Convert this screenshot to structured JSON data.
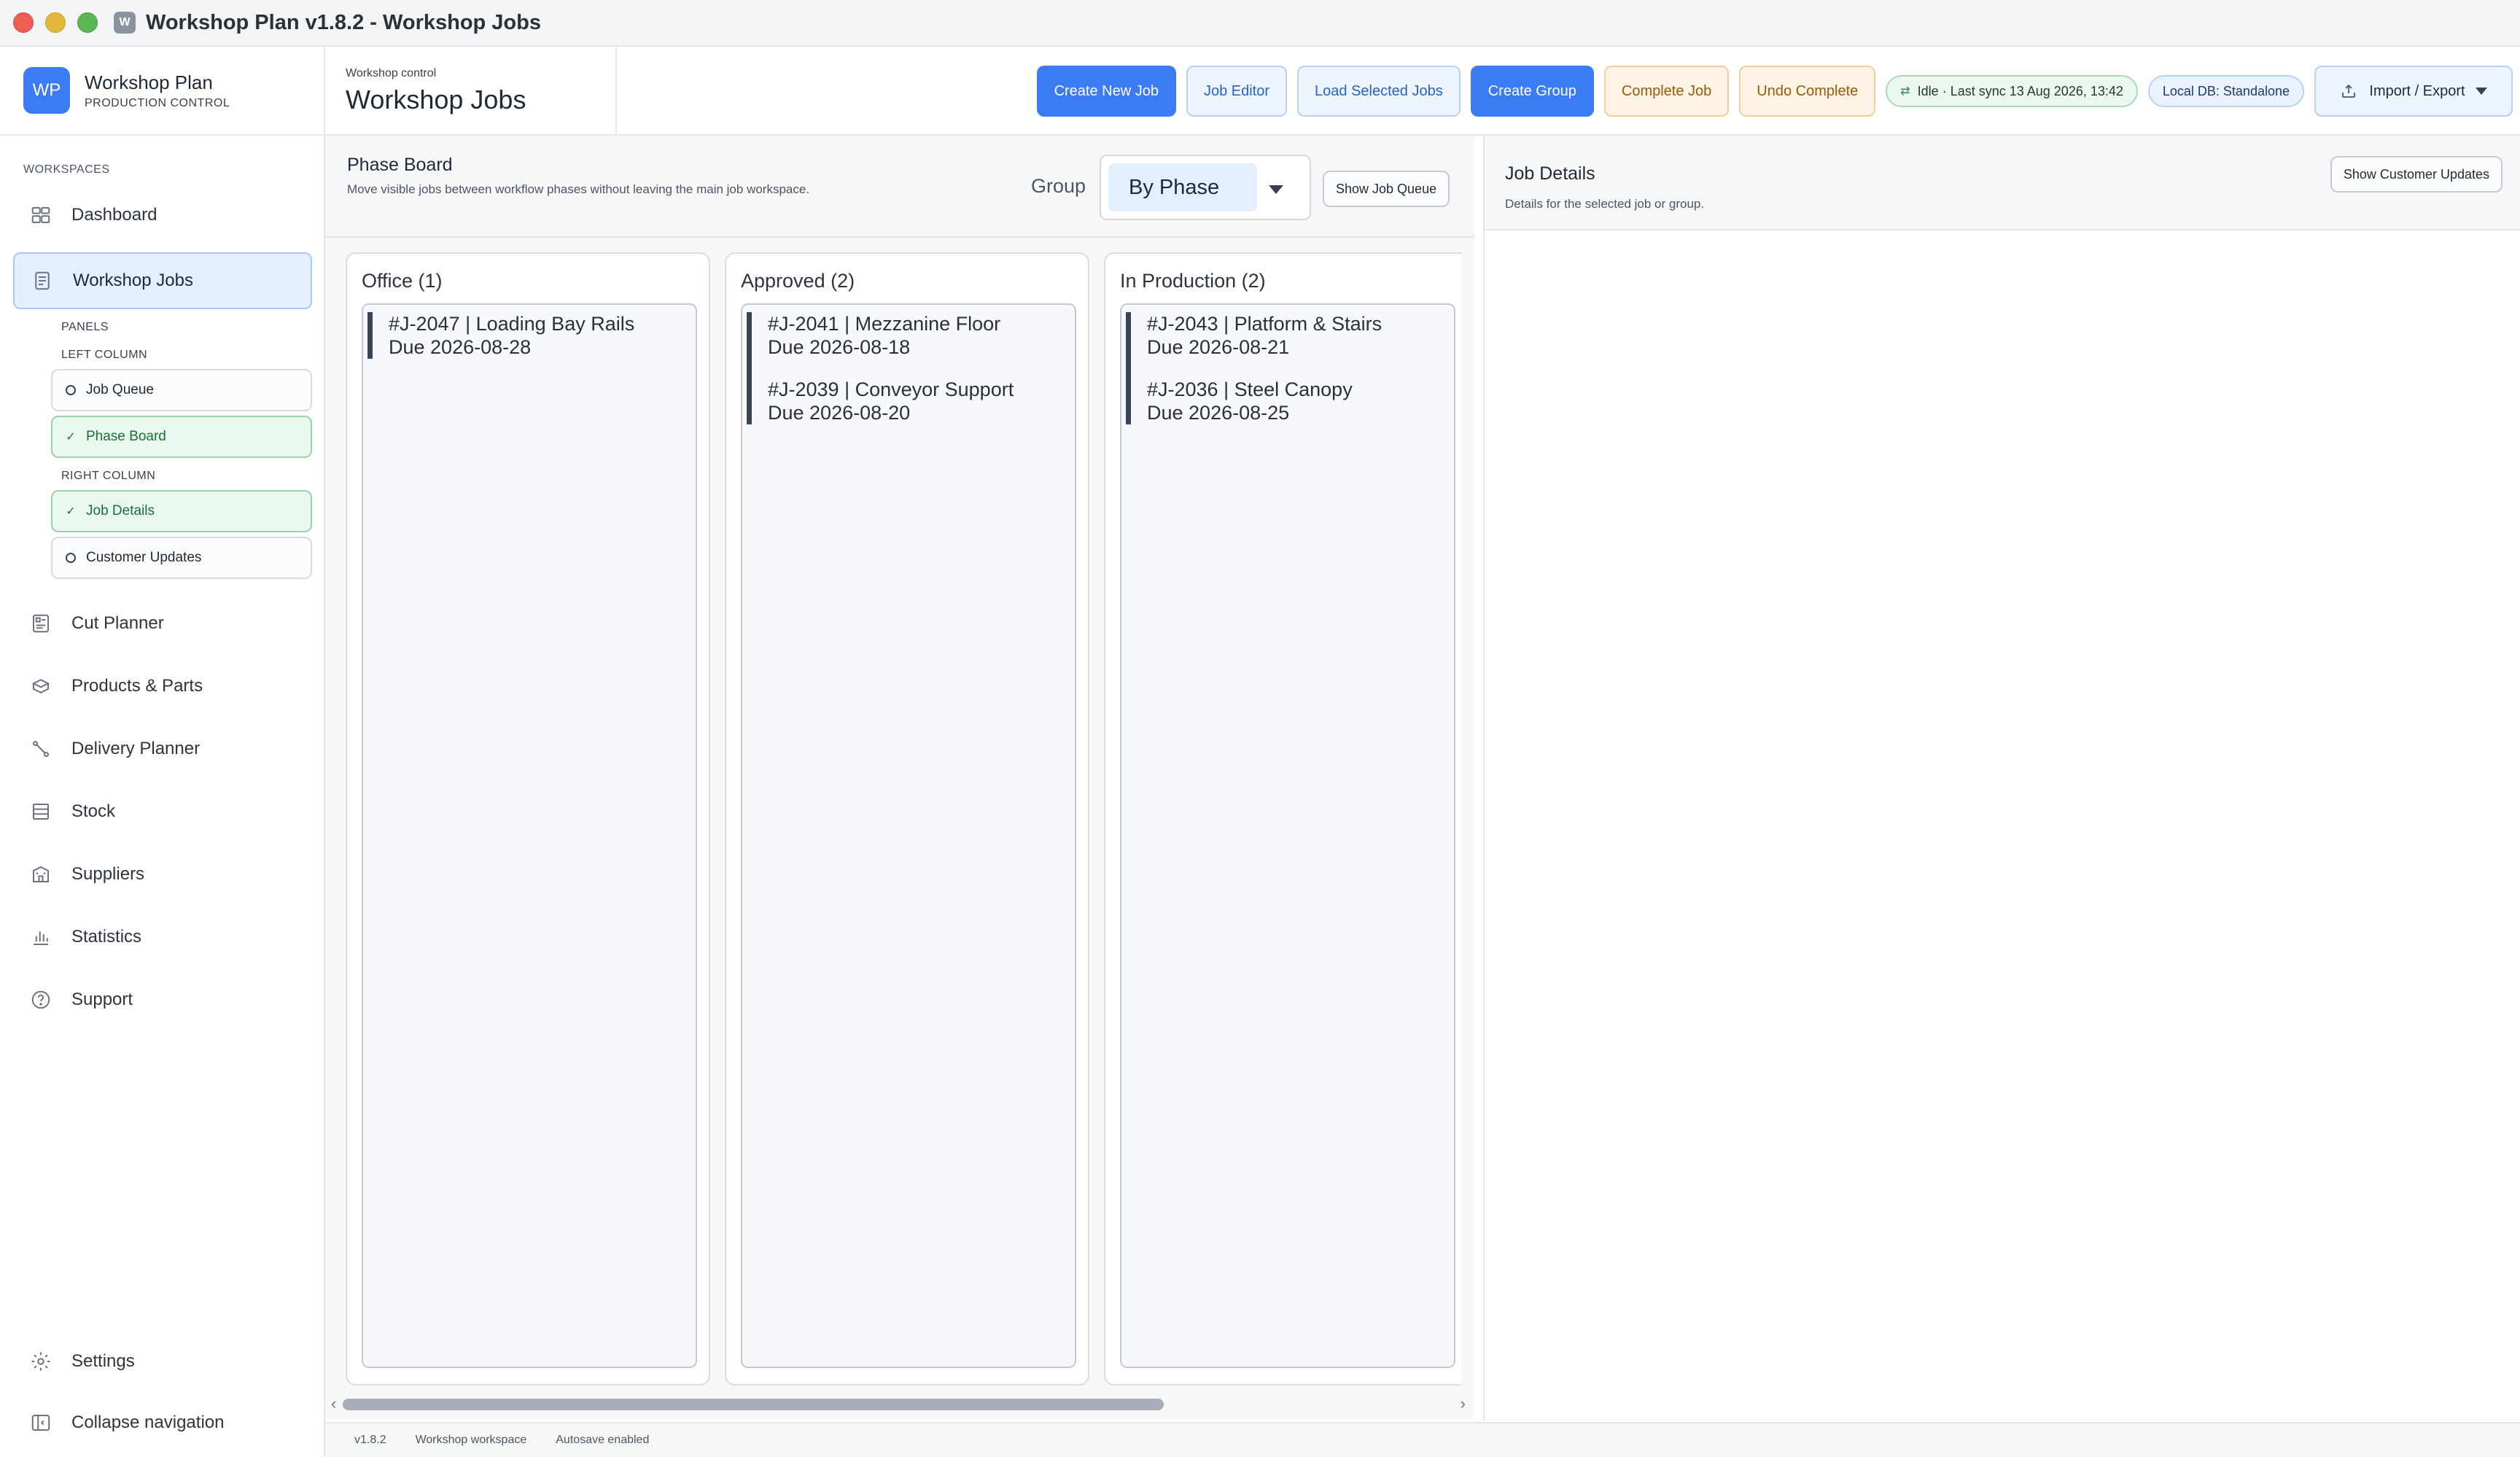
{
  "window": {
    "title": "Workshop Plan v1.8.2 - Workshop Jobs"
  },
  "brand": {
    "logo": "WP",
    "name": "Workshop Plan",
    "subtitle": "PRODUCTION CONTROL"
  },
  "sidebar": {
    "section_label": "WORKSPACES",
    "items": [
      {
        "label": "Dashboard",
        "icon": "dashboard-icon"
      },
      {
        "label": "Workshop Jobs",
        "icon": "document-icon",
        "active": true
      },
      {
        "label": "Cut Planner",
        "icon": "cut-planner-icon"
      },
      {
        "label": "Products & Parts",
        "icon": "parts-icon"
      },
      {
        "label": "Delivery Planner",
        "icon": "route-icon"
      },
      {
        "label": "Stock",
        "icon": "stock-icon"
      },
      {
        "label": "Suppliers",
        "icon": "building-icon"
      },
      {
        "label": "Statistics",
        "icon": "bar-chart-icon"
      },
      {
        "label": "Support",
        "icon": "help-icon"
      }
    ],
    "panels": {
      "heading": "PANELS",
      "left_heading": "LEFT COLUMN",
      "right_heading": "RIGHT COLUMN",
      "left": [
        {
          "label": "Job Queue",
          "on": false
        },
        {
          "label": "Phase Board",
          "on": true
        }
      ],
      "right": [
        {
          "label": "Job Details",
          "on": true
        },
        {
          "label": "Customer Updates",
          "on": false
        }
      ]
    },
    "settings_label": "Settings",
    "collapse_label": "Collapse navigation"
  },
  "header": {
    "crumb": "Workshop control",
    "title": "Workshop Jobs",
    "buttons": {
      "create_new_job": "Create New Job",
      "job_editor": "Job Editor",
      "load_selected_jobs": "Load Selected Jobs",
      "create_group": "Create Group",
      "complete_job": "Complete Job",
      "undo_complete": "Undo Complete",
      "import_export": "Import / Export"
    },
    "status_pill": "Idle · Last sync 13 Aug 2026, 13:42",
    "db_pill": "Local DB: Standalone"
  },
  "board": {
    "title": "Phase Board",
    "subtitle": "Move visible jobs between workflow phases without leaving the main job workspace.",
    "group_label": "Group",
    "group_value": "By Phase",
    "show_queue_label": "Show Job Queue",
    "columns": [
      {
        "title": "Office (1)",
        "jobs": [
          {
            "line1": "#J-2047 | Loading Bay Rails",
            "line2": "Due 2026-08-28"
          }
        ]
      },
      {
        "title": "Approved (2)",
        "jobs": [
          {
            "line1": "#J-2041 | Mezzanine Floor",
            "line2": "Due 2026-08-18"
          },
          {
            "line1": "#J-2039 | Conveyor Support",
            "line2": "Due 2026-08-20"
          }
        ]
      },
      {
        "title": "In Production (2)",
        "jobs": [
          {
            "line1": "#J-2043 | Platform & Stairs",
            "line2": "Due 2026-08-21"
          },
          {
            "line1": "#J-2036 | Steel Canopy",
            "line2": "Due 2026-08-25"
          }
        ]
      }
    ]
  },
  "details": {
    "title": "Job Details",
    "subtitle": "Details for the selected job or group.",
    "show_updates_label": "Show Customer Updates"
  },
  "statusbar": {
    "version": "v1.8.2",
    "workspace": "Workshop workspace",
    "autosave": "Autosave enabled"
  }
}
